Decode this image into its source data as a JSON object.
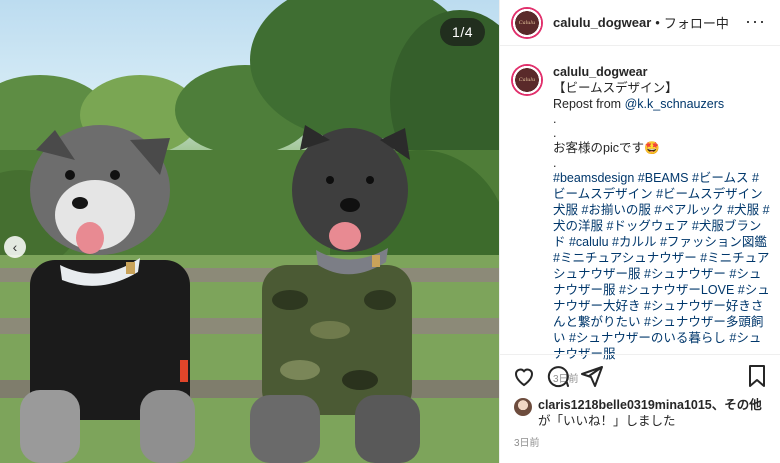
{
  "photo": {
    "counter": "1/4",
    "prev_icon": "chevron-left-icon"
  },
  "header": {
    "avatar_text": "Calulu",
    "username": "calulu_dogwear",
    "separator": "•",
    "follow_status": "フォロー中",
    "more_icon": "more-horizontal-icon"
  },
  "caption": {
    "username": "calulu_dogwear",
    "title": "【ビームスデザイン】",
    "repost_label": "Repost from",
    "repost_user": "@k.k_schnauzers",
    "dot1": ".",
    "dot2": ".",
    "message": "お客様のpicです🤩",
    "dot3": ".",
    "hashtags": "#beamsdesign #BEAMS #ビームス #ビームスデザイン #ビームスデザイン犬服 #お揃いの服 #ペアルック #犬服 #犬の洋服 #ドッグウェア #犬服ブランド #calulu #カルル #ファッション図鑑 #ミニチュアシュナウザー #ミニチュアシュナウザー服 #シュナウザー #シュナウザー服 #シュナウザーLOVE #シュナウザー大好き #シュナウザー好きさんと繋がりたい #シュナウザー多頭飼い #シュナウザーのいる暮らし #シュナウザー服",
    "time": "3日前"
  },
  "actions": {
    "like_icon": "heart-icon",
    "comment_icon": "comment-icon",
    "share_icon": "share-icon",
    "save_icon": "bookmark-icon"
  },
  "likes": {
    "users": "claris1218belle0319mina1015",
    "connector": "、その他",
    "suffix": "が「いいね！」しました",
    "date": "3日前"
  }
}
